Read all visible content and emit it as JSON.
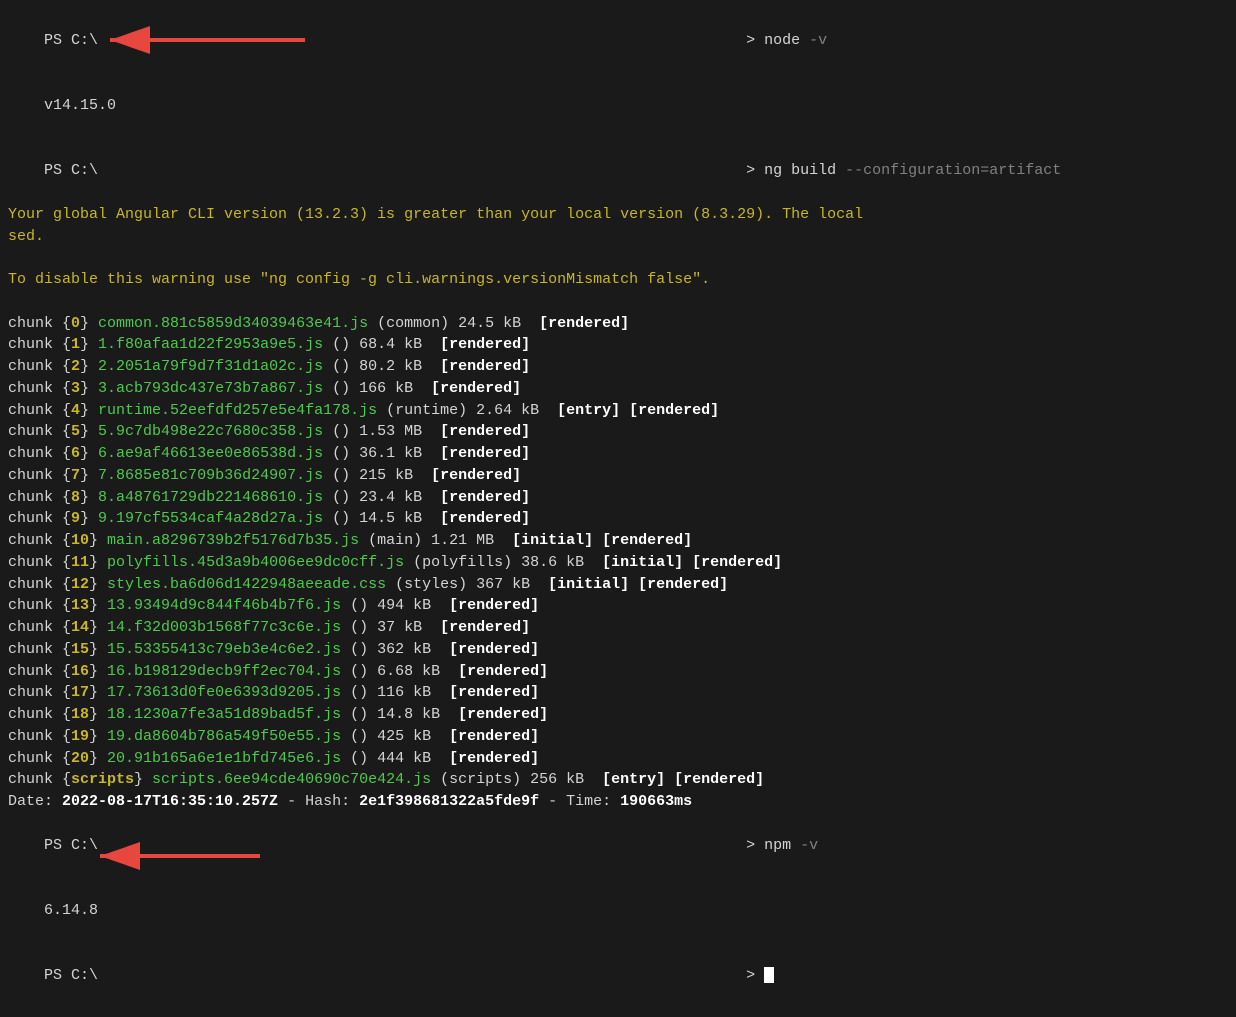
{
  "terminal": {
    "lines": [
      {
        "type": "prompt",
        "ps": "PS C:\\",
        "cmd": "node",
        "flag": " -v"
      },
      {
        "type": "output-version",
        "text": "v14.15.0",
        "arrow": true,
        "arrow_id": "v14"
      },
      {
        "type": "prompt2",
        "ps": "PS C:\\"
      },
      {
        "type": "prompt-inline",
        "ps": "PS C:\\",
        "cmd": "ng build",
        "flag": " --configuration=artifact"
      },
      {
        "type": "warning-yellow",
        "text": "Your global Angular CLI version (13.2.3) is greater than your local version (8.3.29). The local"
      },
      {
        "type": "warning-yellow",
        "text": "sed."
      },
      {
        "type": "blank"
      },
      {
        "type": "warning-yellow",
        "text": "To disable this warning use \"ng config -g cli.warnings.versionMismatch false\"."
      },
      {
        "type": "blank"
      },
      {
        "type": "chunk",
        "num": "0",
        "file": "common.881c5859d34039463e41.js",
        "label": "(common)",
        "size": "24.5 kB",
        "tags": "[rendered]"
      },
      {
        "type": "chunk",
        "num": "1",
        "file": "1.f80afaa1d22f2953a9e5.js",
        "label": "()",
        "size": "68.4 kB",
        "tags": "[rendered]"
      },
      {
        "type": "chunk",
        "num": "2",
        "file": "2.2051a79f9d7f31d1a02c.js",
        "label": "()",
        "size": "80.2 kB",
        "tags": "[rendered]"
      },
      {
        "type": "chunk",
        "num": "3",
        "file": "3.acb793dc437e73b7a867.js",
        "label": "()",
        "size": "166 kB",
        "tags": "[rendered]"
      },
      {
        "type": "chunk",
        "num": "4",
        "file": "runtime.52eefdfd257e5e4fa178.js",
        "label": "(runtime)",
        "size": "2.64 kB",
        "tags": "[entry] [rendered]"
      },
      {
        "type": "chunk",
        "num": "5",
        "file": "5.9c7db498e22c7680c358.js",
        "label": "()",
        "size": "1.53 MB",
        "tags": "[rendered]"
      },
      {
        "type": "chunk",
        "num": "6",
        "file": "6.ae9af46613ee0e86538d.js",
        "label": "()",
        "size": "36.1 kB",
        "tags": "[rendered]"
      },
      {
        "type": "chunk",
        "num": "7",
        "file": "7.8685e81c709b36d24907.js",
        "label": "()",
        "size": "215 kB",
        "tags": "[rendered]"
      },
      {
        "type": "chunk",
        "num": "8",
        "file": "8.a48761729db221468610.js",
        "label": "()",
        "size": "23.4 kB",
        "tags": "[rendered]"
      },
      {
        "type": "chunk",
        "num": "9",
        "file": "9.197cf5534caf4a28d27a.js",
        "label": "()",
        "size": "14.5 kB",
        "tags": "[rendered]"
      },
      {
        "type": "chunk",
        "num": "10",
        "file": "main.a8296739b2f5176d7b35.js",
        "label": "(main)",
        "size": "1.21 MB",
        "tags": "[initial] [rendered]"
      },
      {
        "type": "chunk",
        "num": "11",
        "file": "polyfills.45d3a9b4006ee9dc0cff.js",
        "label": "(polyfills)",
        "size": "38.6 kB",
        "tags": "[initial] [rendered]"
      },
      {
        "type": "chunk",
        "num": "12",
        "file": "styles.ba6d06d1422948aeeade.css",
        "label": "(styles)",
        "size": "367 kB",
        "tags": "[initial] [rendered]"
      },
      {
        "type": "chunk",
        "num": "13",
        "file": "13.93494d9c844f46b4b7f6.js",
        "label": "()",
        "size": "494 kB",
        "tags": "[rendered]"
      },
      {
        "type": "chunk",
        "num": "14",
        "file": "14.f32d003b1568f77c3c6e.js",
        "label": "()",
        "size": "37 kB",
        "tags": "[rendered]"
      },
      {
        "type": "chunk",
        "num": "15",
        "file": "15.53355413c79eb3e4c6e2.js",
        "label": "()",
        "size": "362 kB",
        "tags": "[rendered]"
      },
      {
        "type": "chunk",
        "num": "16",
        "file": "16.b198129decb9ff2ec704.js",
        "label": "()",
        "size": "6.68 kB",
        "tags": "[rendered]"
      },
      {
        "type": "chunk",
        "num": "17",
        "file": "17.73613d0fe0e6393d9205.js",
        "label": "()",
        "size": "116 kB",
        "tags": "[rendered]"
      },
      {
        "type": "chunk",
        "num": "18",
        "file": "18.1230a7fe3a51d89bad5f.js",
        "label": "()",
        "size": "14.8 kB",
        "tags": "[rendered]"
      },
      {
        "type": "chunk",
        "num": "19",
        "file": "19.da8604b786a549f50e55.js",
        "label": "()",
        "size": "425 kB",
        "tags": "[rendered]"
      },
      {
        "type": "chunk",
        "num": "20",
        "file": "20.91b165a6e1e1bfd745e6.js",
        "label": "()",
        "size": "444 kB",
        "tags": "[rendered]"
      },
      {
        "type": "chunk-scripts",
        "num": "scripts",
        "file": "scripts.6ee94cde40690c70e424.js",
        "label": "(scripts)",
        "size": "256 kB",
        "tags": "[entry] [rendered]"
      },
      {
        "type": "date-line",
        "text": "Date: 2022-08-17T16:35:10.257Z - Hash: 2e1f398681322a5fde9f - Time: 190663ms"
      },
      {
        "type": "prompt-npm",
        "ps": "PS C:\\",
        "cmd": "npm",
        "flag": " -v"
      },
      {
        "type": "output-version-npm",
        "text": "6.14.8",
        "arrow": true,
        "arrow_id": "npm"
      },
      {
        "type": "prompt-final",
        "ps": "PS C:\\"
      }
    ]
  }
}
